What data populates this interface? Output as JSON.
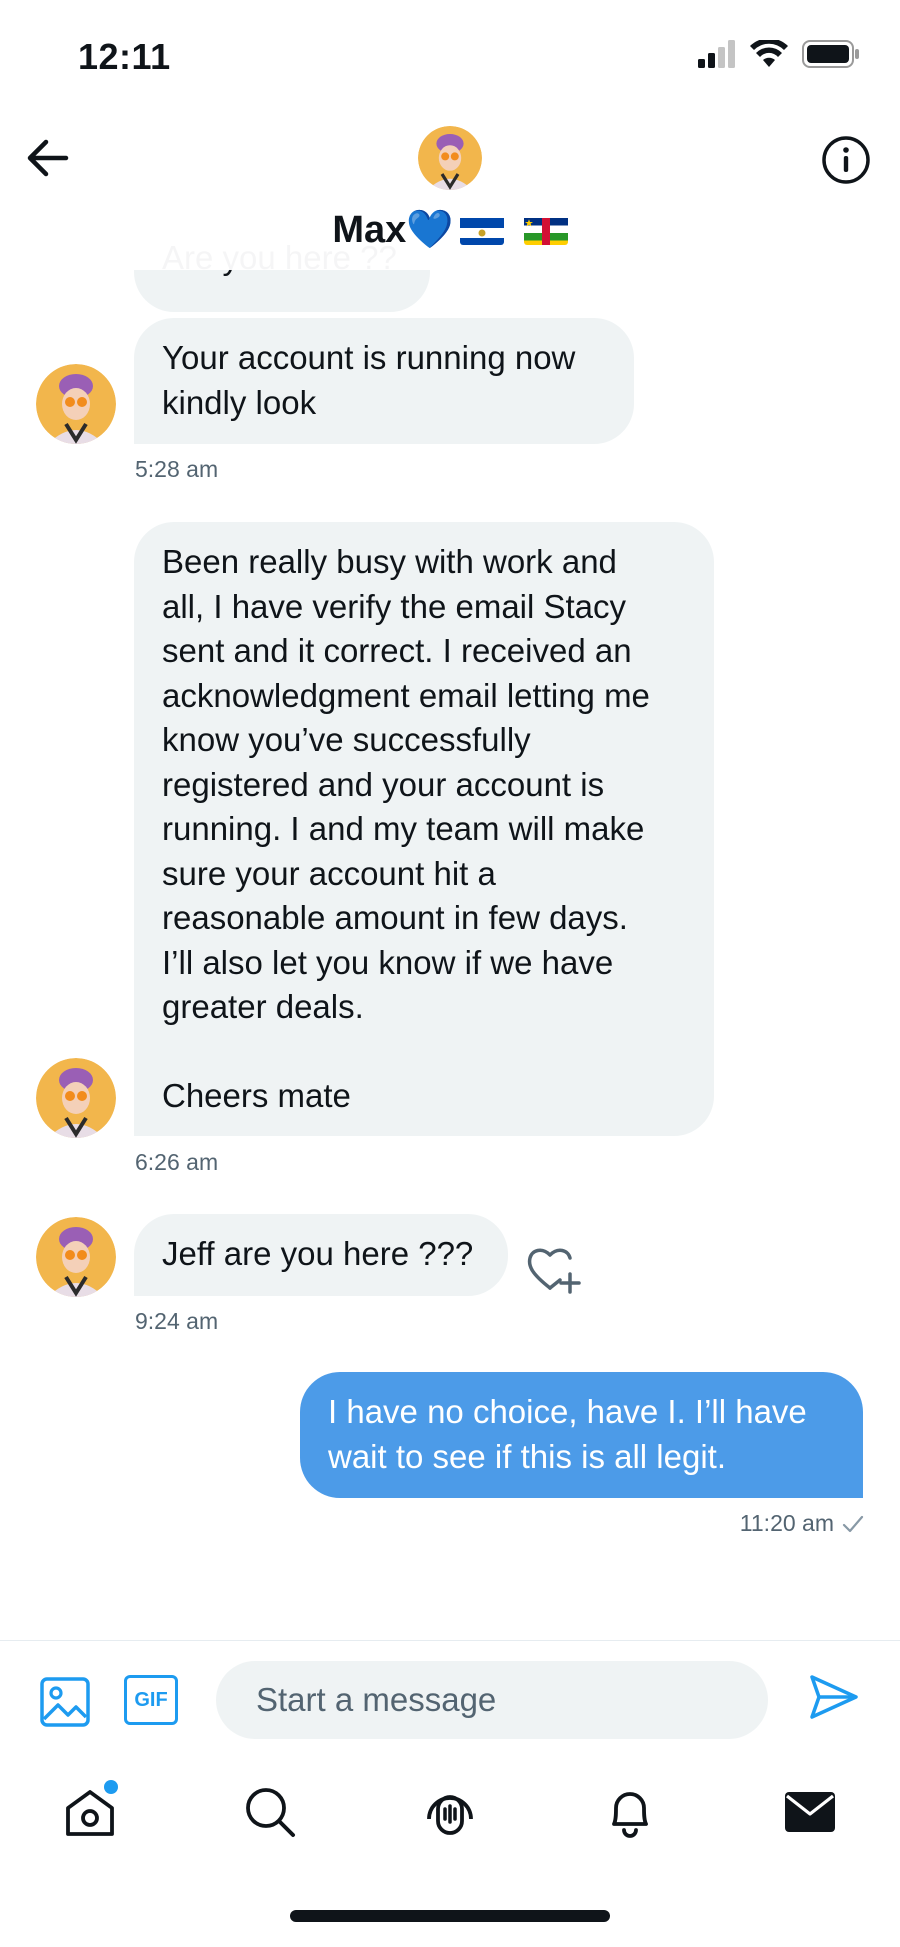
{
  "status_bar": {
    "time": "12:11"
  },
  "header": {
    "name": "Max💙",
    "flag_icons": [
      "el-salvador-flag-icon",
      "central-african-republic-flag-icon"
    ]
  },
  "conversation": {
    "partial_message": "Are you here ??",
    "messages": [
      {
        "direction": "in",
        "text": "Your account is running now\nkindly look",
        "time": "5:28 am"
      },
      {
        "direction": "in",
        "text": "Been really busy with work and\nall, I have verify the email Stacy\nsent and it correct. I received an\nacknowledgment email letting me\nknow you’ve successfully\nregistered and your account is\nrunning. I and my team will make\nsure your account hit a\nreasonable amount in few days.\nI’ll also let you know if we have\ngreater deals.\n\nCheers mate",
        "time": "6:26 am"
      },
      {
        "direction": "in",
        "text": "Jeff are you here ???",
        "time": "9:24 am"
      },
      {
        "direction": "out",
        "text": "I have no choice, have I. I’ll have\nwait to see if this is all legit.",
        "time": "11:20 am"
      }
    ]
  },
  "composer": {
    "placeholder": "Start a message",
    "gif_label": "GIF"
  },
  "nav": {
    "items": [
      "home",
      "search",
      "spaces",
      "notifications",
      "messages"
    ],
    "home_has_badge": true
  },
  "colors": {
    "accent": "#1d9bf0",
    "outgoing_bubble": "#4c9be8",
    "incoming_bubble": "#eff3f4",
    "text_secondary": "#536471"
  }
}
